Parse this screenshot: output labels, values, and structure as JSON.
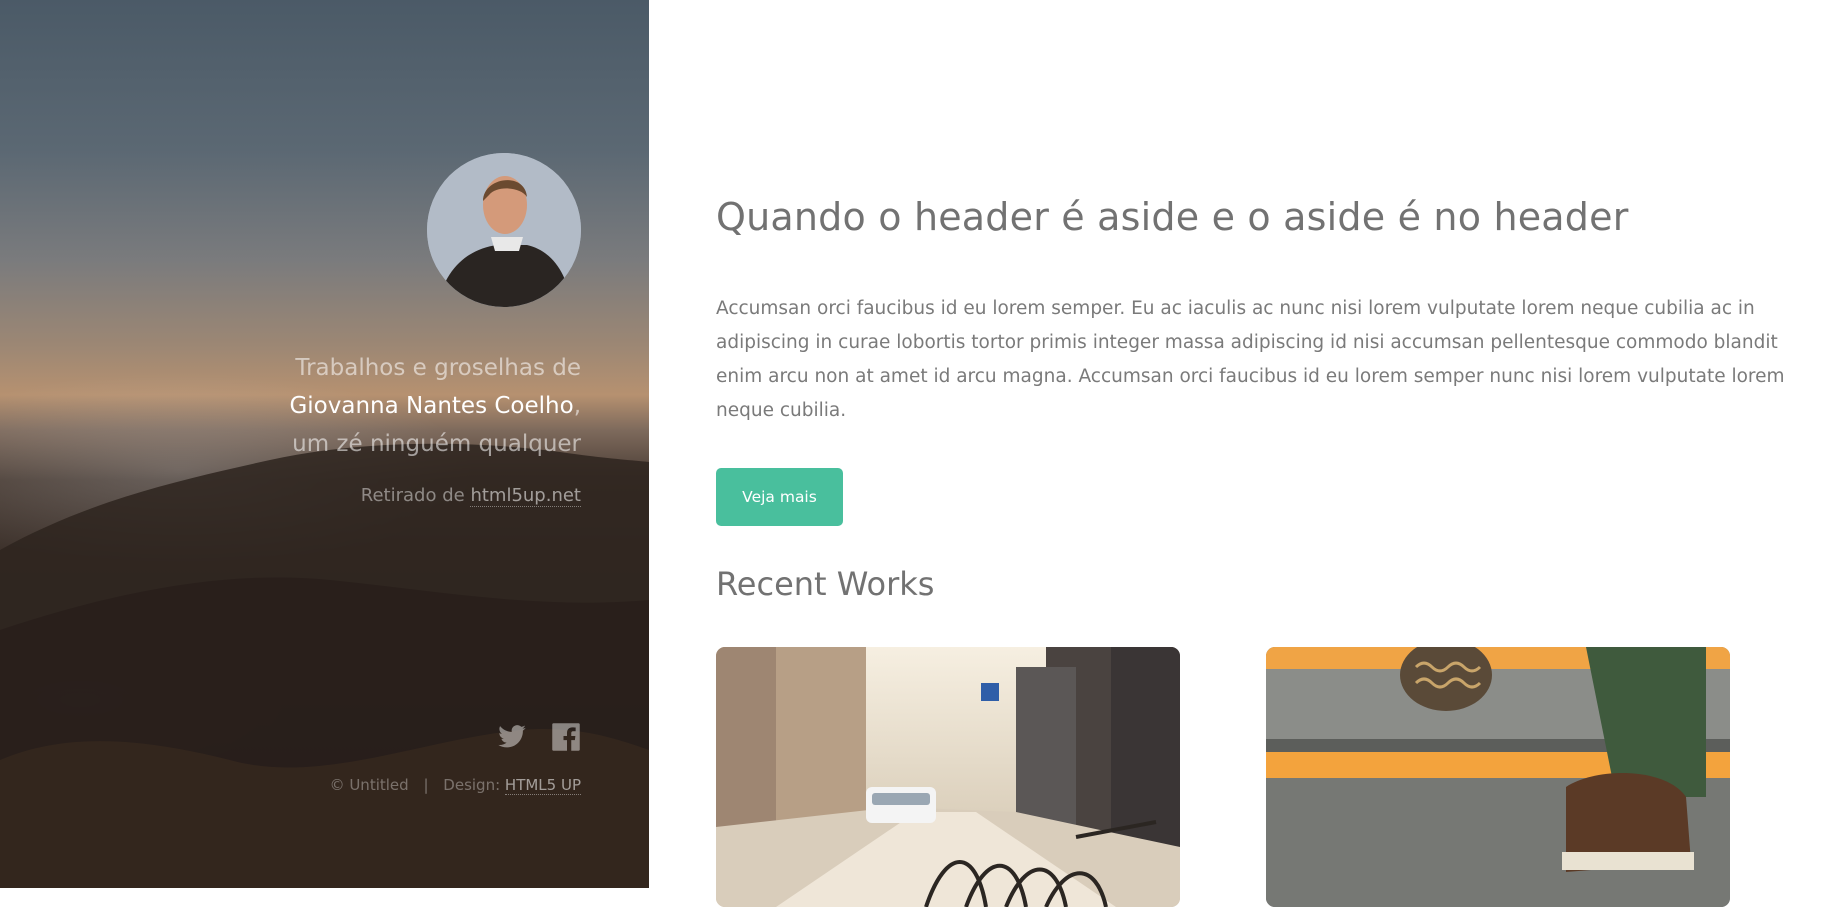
{
  "sidebar": {
    "intro_prefix": "Trabalhos e groselhas de",
    "name": "Giovanna Nantes Coelho",
    "comma": ",",
    "intro_suffix": "um zé ninguém qualquer",
    "credit_prefix": "Retirado de",
    "credit_link": "html5up.net",
    "copyright": "© Untitled",
    "separator": "|",
    "design_label": "Design:",
    "design_link": "HTML5 UP"
  },
  "main": {
    "title": "Quando o header é aside e o aside é no header",
    "body": "Accumsan orci faucibus id eu lorem semper. Eu ac iaculis ac nunc nisi lorem vulputate lorem neque cubilia ac in adipiscing in curae lobortis tortor primis integer massa adipiscing id nisi accumsan pellentesque commodo blandit enim arcu non at amet id arcu magna. Accumsan orci faucibus id eu lorem semper nunc nisi lorem vulputate lorem neque cubilia.",
    "button": "Veja mais",
    "recent_title": "Recent Works"
  },
  "colors": {
    "accent": "#49bf9d",
    "heading": "#727272",
    "text": "#7a7a7a"
  },
  "icons": [
    "twitter-icon",
    "facebook-icon"
  ]
}
